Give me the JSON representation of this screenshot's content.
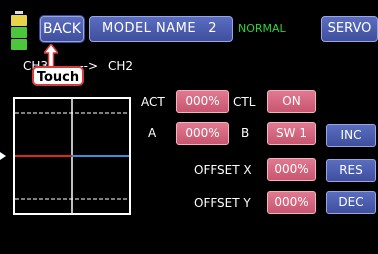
{
  "header": {
    "back_label": "BACK",
    "model_label": "MODEL NAME",
    "model_number": "2",
    "mode": "NORMAL",
    "servo_label": "SERVO"
  },
  "channel": {
    "from": "CH3",
    "arrow": "--->",
    "to": "CH2"
  },
  "callout": {
    "touch_label": "Touch"
  },
  "params": {
    "act_label": "ACT",
    "act_value": "000%",
    "ctl_label": "CTL",
    "ctl_value": "ON",
    "a_label": "A",
    "a_value": "000%",
    "b_label": "B",
    "b_value": "SW 1",
    "offset_x_label": "OFFSET X",
    "offset_x_value": "000%",
    "offset_y_label": "OFFSET Y",
    "offset_y_value": "000%"
  },
  "side_buttons": {
    "inc": "INC",
    "res": "RES",
    "dec": "DEC"
  },
  "colors": {
    "left_line": "#d62a2a",
    "right_line": "#3b8fd8",
    "mode_text": "#2ed23b",
    "value_button": "#c85570",
    "nav_button": "#3f4f9e"
  }
}
